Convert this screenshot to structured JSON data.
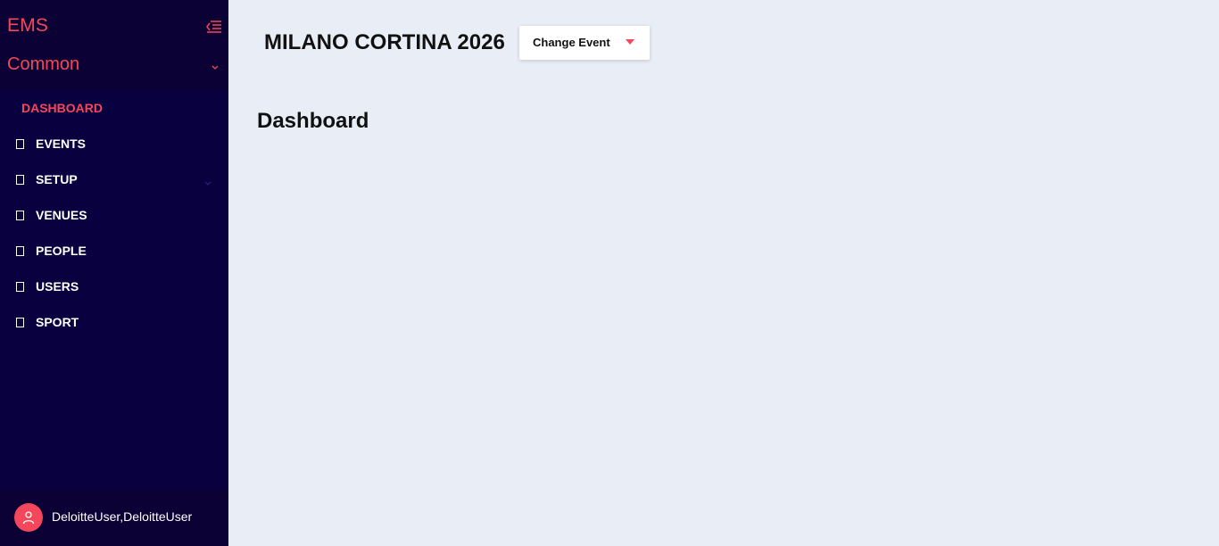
{
  "sidebar": {
    "brand": "EMS",
    "module": "Common",
    "items": [
      {
        "label": "DASHBOARD",
        "active": true
      },
      {
        "label": "EVENTS"
      },
      {
        "label": "SETUP",
        "has_children": true
      },
      {
        "label": "VENUES"
      },
      {
        "label": "PEOPLE"
      },
      {
        "label": "USERS"
      },
      {
        "label": "SPORT"
      }
    ],
    "user": {
      "name": "DeloitteUser,DeloitteUser"
    }
  },
  "header": {
    "event_title": "MILANO CORTINA 2026",
    "change_event_label": "Change Event"
  },
  "main": {
    "page_title": "Dashboard"
  },
  "colors": {
    "accent": "#f5475b",
    "sidebar_bg": "#08003f",
    "page_bg": "#e9eef6"
  }
}
